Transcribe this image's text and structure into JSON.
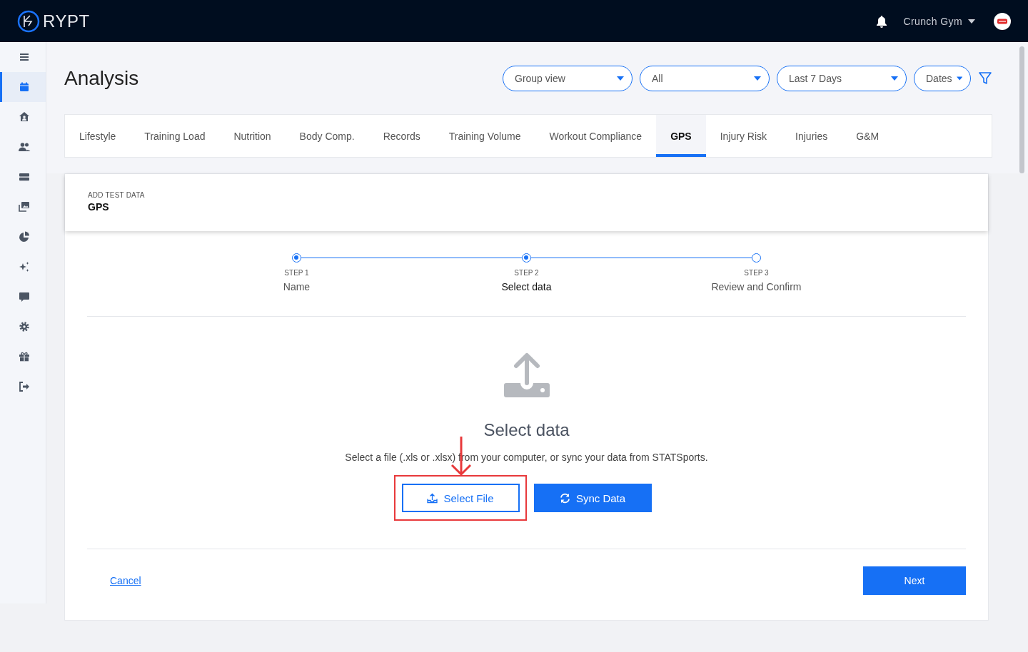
{
  "topbar": {
    "brand": "RYPT",
    "account": "Crunch Gym"
  },
  "sidebar": {
    "items": [
      {
        "selected": false
      },
      {
        "selected": true
      },
      {
        "selected": false
      },
      {
        "selected": false
      },
      {
        "selected": false
      },
      {
        "selected": false
      },
      {
        "selected": false
      },
      {
        "selected": false
      },
      {
        "selected": false
      },
      {
        "selected": false
      },
      {
        "selected": false
      },
      {
        "selected": false
      }
    ]
  },
  "page": {
    "title": "Analysis",
    "filters": [
      {
        "value": "Group view"
      },
      {
        "value": "All"
      },
      {
        "value": "Last 7 Days"
      },
      {
        "value": "Dates"
      }
    ]
  },
  "tabs": [
    {
      "label": "Lifestyle",
      "selected": false
    },
    {
      "label": "Training Load",
      "selected": false
    },
    {
      "label": "Nutrition",
      "selected": false
    },
    {
      "label": "Body Comp.",
      "selected": false
    },
    {
      "label": "Records",
      "selected": false
    },
    {
      "label": "Training Volume",
      "selected": false
    },
    {
      "label": "Workout Compliance",
      "selected": false
    },
    {
      "label": "GPS",
      "selected": true
    },
    {
      "label": "Injury Risk",
      "selected": false
    },
    {
      "label": "Injuries",
      "selected": false
    },
    {
      "label": "G&M",
      "selected": false
    }
  ],
  "card": {
    "overline": "ADD TEST DATA",
    "title": "GPS",
    "steps": [
      {
        "label": "STEP 1",
        "name": "Name",
        "done": true,
        "selected": false
      },
      {
        "label": "STEP 2",
        "name": "Select data",
        "done": true,
        "selected": true
      },
      {
        "label": "STEP 3",
        "name": "Review and Confirm",
        "done": false,
        "selected": false
      }
    ],
    "content": {
      "title": "Select data",
      "description": "Select a file (.xls or .xlsx) from your computer, or sync your data from STATSports.",
      "buttons": [
        {
          "label": "Select File",
          "kind": "outline",
          "highlighted": true
        },
        {
          "label": "Sync Data",
          "kind": "solid",
          "highlighted": false
        }
      ]
    },
    "footer": {
      "cancel": "Cancel",
      "next": "Next"
    }
  }
}
